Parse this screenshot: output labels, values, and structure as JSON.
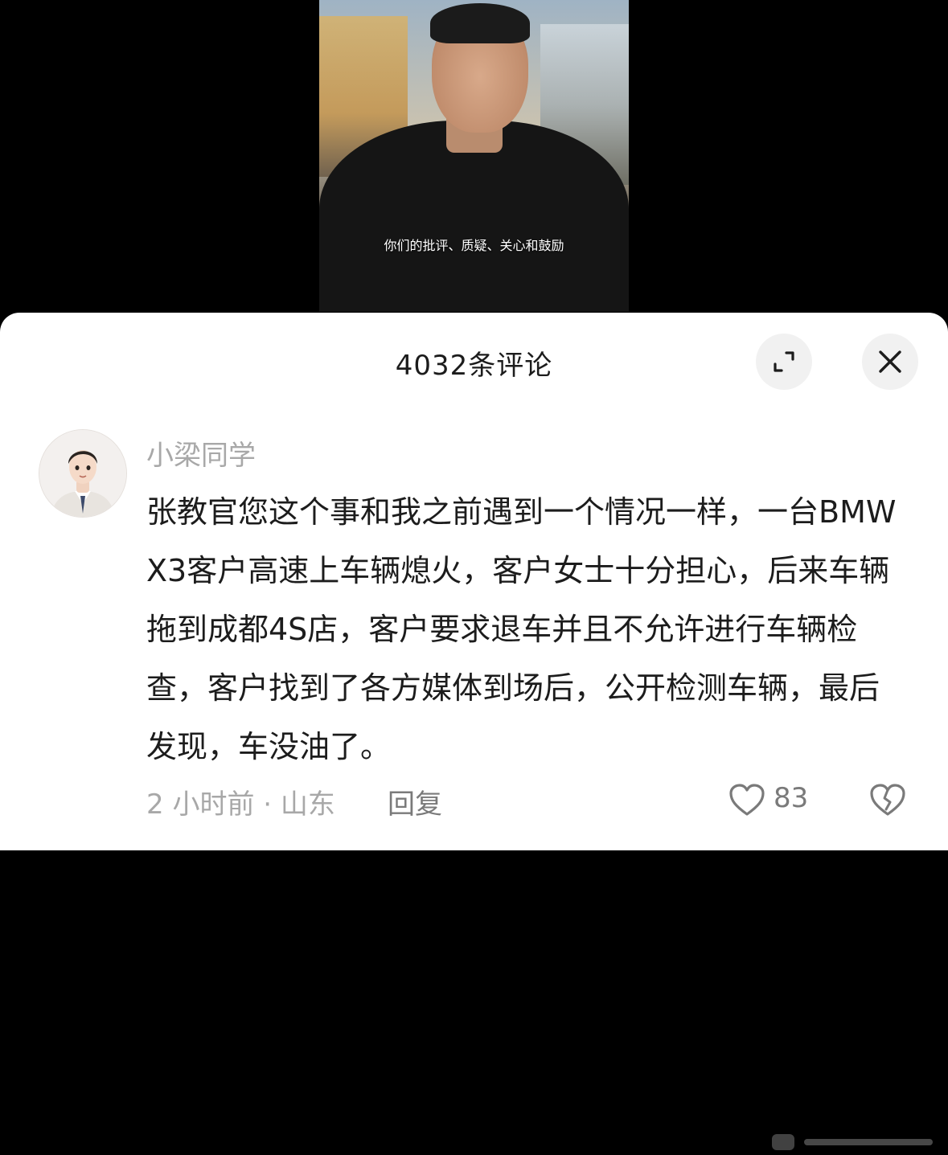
{
  "video": {
    "subtitle": "你们的批评、质疑、关心和鼓励"
  },
  "sheet": {
    "title": "4032条评论",
    "expand_icon": "expand-icon",
    "close_icon": "close-icon"
  },
  "comment": {
    "username": "小梁同学",
    "text": "张教官您这个事和我之前遇到一个情况一样，一台BMW X3客户高速上车辆熄火，客户女士十分担心，后来车辆拖到成都4S店，客户要求退车并且不允许进行车辆检查，客户找到了各方媒体到场后，公开检测车辆，最后发现，车没油了。",
    "time_location": "2 小时前 · 山东",
    "reply_label": "回复",
    "like_count": "83",
    "like_icon": "heart-outline-icon",
    "dislike_icon": "broken-heart-icon"
  },
  "colors": {
    "sheet_bg": "#ffffff",
    "text_primary": "#1c1c1c",
    "text_secondary": "#a8a8a8",
    "button_bg": "#f1f1f1"
  }
}
